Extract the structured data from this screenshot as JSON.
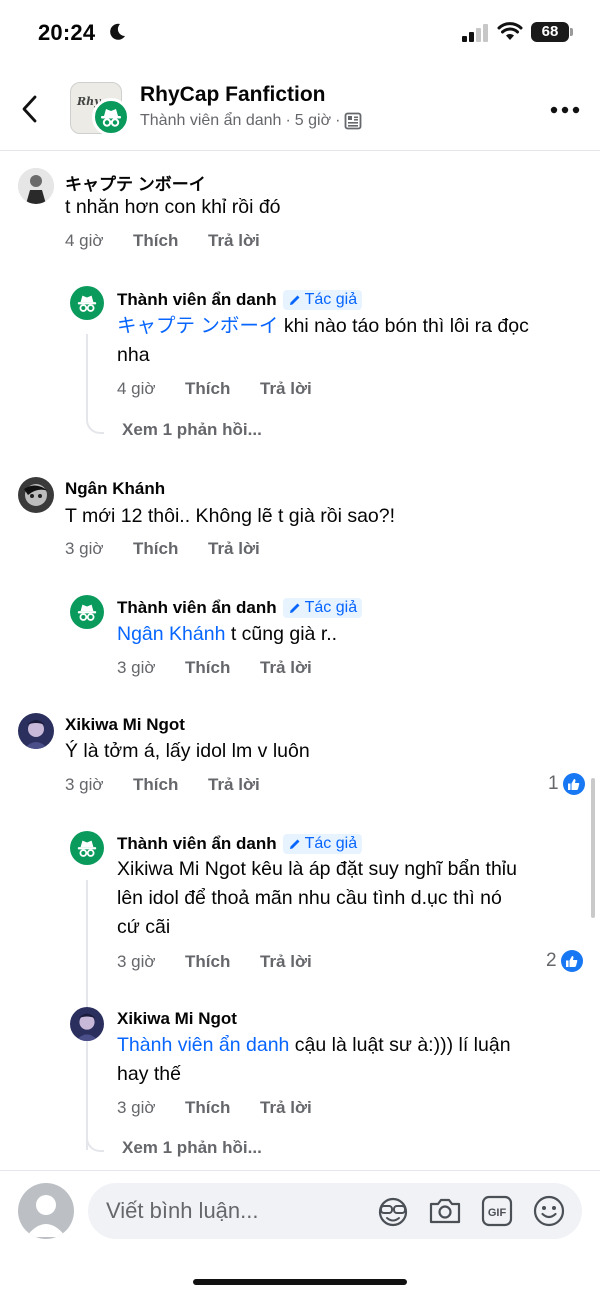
{
  "status_bar": {
    "time": "20:24",
    "battery": "68"
  },
  "header": {
    "title": "RhyCap Fanfiction",
    "subtitle_user": "Thành viên ẩn danh",
    "subtitle_sep": "·",
    "subtitle_time": "5 giờ",
    "group_image_text": "Rhy"
  },
  "actions": {
    "like": "Thích",
    "reply": "Trả lời"
  },
  "comments": [
    {
      "name": "キャプテ ンボーイ",
      "text": "t nhăn hơn con khỉ rồi đó",
      "time": "4 giờ",
      "reply": {
        "name": "Thành viên ẩn danh",
        "badge": "Tác giả",
        "mention": "キャプテ ンボーイ",
        "text_line1": " khi nào táo bón thì lôi ra đọc",
        "text_line2": "nha",
        "time": "4 giờ"
      },
      "more_replies": "Xem 1 phản hồi..."
    },
    {
      "name": "Ngân Khánh",
      "text": "T mới 12 thôi.. Không lẽ t già rồi sao?!",
      "time": "3 giờ",
      "reply": {
        "name": "Thành viên ẩn danh",
        "badge": "Tác giả",
        "mention": "Ngân Khánh",
        "text_line1": " t cũng già r..",
        "time": "3 giờ"
      }
    },
    {
      "name": "Xikiwa Mi Ngot",
      "text": "Ý là tởm á, lấy idol lm v luôn",
      "time": "3 giờ",
      "reactions": "1",
      "reply": {
        "name": "Thành viên ẩn danh",
        "badge": "Tác giả",
        "text_line1": "Xikiwa Mi Ngot kêu là áp đặt suy nghĩ bẩn thỉu",
        "text_line2": "lên idol để thoả mãn nhu cầu tình d.ục thì nó",
        "text_line3": "cứ cãi",
        "time": "3 giờ",
        "reactions": "2"
      },
      "reply2": {
        "name": "Xikiwa Mi Ngot",
        "mention": "Thành viên ẩn danh",
        "text_line1": " cậu là luật sư à:))) lí luận",
        "text_line2": "hay thế",
        "time": "3 giờ"
      },
      "more_replies": "Xem 1 phản hồi..."
    }
  ],
  "composer": {
    "placeholder": "Viết bình luận..."
  },
  "icons": [
    "moon-icon",
    "signal-icon",
    "wifi-icon",
    "back-icon",
    "more-icon",
    "like-icon",
    "avatar-icon",
    "sticker-icon",
    "camera-icon",
    "gif-icon",
    "emoji-icon"
  ],
  "colors": {
    "accent": "#0866ff",
    "anon_green": "#0a9a5c",
    "muted": "#65676b",
    "badge_bg": "#e7f3ff"
  }
}
